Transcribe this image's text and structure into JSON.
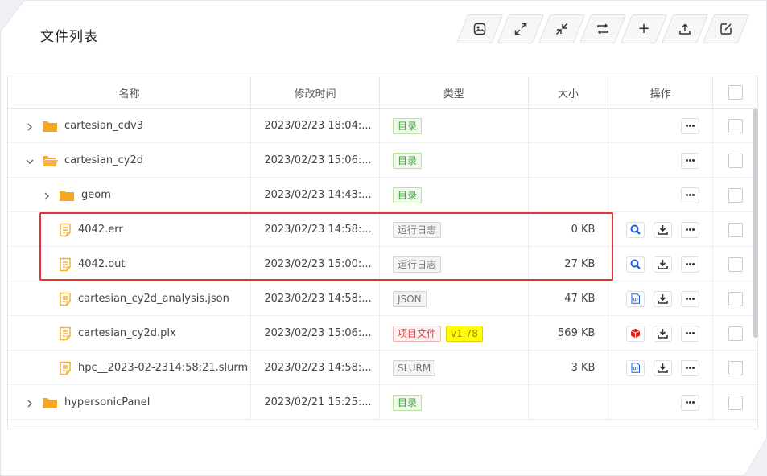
{
  "page": {
    "title": "文件列表"
  },
  "toolbar": {
    "buttons": [
      {
        "icon": "image-icon"
      },
      {
        "icon": "expand-icon"
      },
      {
        "icon": "collapse-icon"
      },
      {
        "icon": "refresh-icon"
      },
      {
        "icon": "plus-icon",
        "label": "+"
      },
      {
        "icon": "upload-icon"
      },
      {
        "icon": "edit-icon"
      }
    ]
  },
  "table": {
    "headers": {
      "name": "名称",
      "time": "修改时间",
      "type": "类型",
      "size": "大小",
      "ops": "操作"
    },
    "rows": [
      {
        "indent": 0,
        "expand": "collapsed",
        "kind": "folder",
        "open": false,
        "name": "cartesian_cdv3",
        "time": "2023/02/23 18:04:...",
        "tags": [
          {
            "text": "目录",
            "style": "green"
          }
        ],
        "size": "",
        "ops": [
          "more"
        ]
      },
      {
        "indent": 0,
        "expand": "expanded",
        "kind": "folder",
        "open": true,
        "name": "cartesian_cy2d",
        "time": "2023/02/23 15:06:...",
        "tags": [
          {
            "text": "目录",
            "style": "green"
          }
        ],
        "size": "",
        "ops": [
          "more"
        ]
      },
      {
        "indent": 1,
        "expand": "collapsed",
        "kind": "folder",
        "open": false,
        "name": "geom",
        "time": "2023/02/23 14:43:...",
        "tags": [
          {
            "text": "目录",
            "style": "green"
          }
        ],
        "size": "",
        "ops": [
          "more"
        ]
      },
      {
        "indent": 1,
        "expand": "none",
        "kind": "file",
        "name": "4042.err",
        "time": "2023/02/23 14:58:...",
        "tags": [
          {
            "text": "运行日志",
            "style": "gray"
          }
        ],
        "size": "0 KB",
        "ops": [
          "search",
          "download",
          "more"
        ]
      },
      {
        "indent": 1,
        "expand": "none",
        "kind": "file",
        "name": "4042.out",
        "time": "2023/02/23 15:00:...",
        "tags": [
          {
            "text": "运行日志",
            "style": "gray"
          }
        ],
        "size": "27 KB",
        "ops": [
          "search",
          "download",
          "more"
        ]
      },
      {
        "indent": 1,
        "expand": "none",
        "kind": "file",
        "name": "cartesian_cy2d_analysis.json",
        "time": "2023/02/23 14:58:...",
        "tags": [
          {
            "text": "JSON",
            "style": "gray"
          }
        ],
        "size": "47 KB",
        "ops": [
          "code",
          "download",
          "more"
        ]
      },
      {
        "indent": 1,
        "expand": "none",
        "kind": "file",
        "name": "cartesian_cy2d.plx",
        "time": "2023/02/23 15:06:...",
        "tags": [
          {
            "text": "项目文件",
            "style": "red"
          },
          {
            "text": "v1.78",
            "style": "yellow"
          }
        ],
        "size": "569 KB",
        "ops": [
          "cube",
          "download",
          "more"
        ]
      },
      {
        "indent": 1,
        "expand": "none",
        "kind": "file",
        "name": "hpc__2023-02-2314:58:21.slurm",
        "time": "2023/02/23 14:58:...",
        "tags": [
          {
            "text": "SLURM",
            "style": "gray"
          }
        ],
        "size": "3 KB",
        "ops": [
          "code",
          "download",
          "more"
        ]
      },
      {
        "indent": 0,
        "expand": "collapsed",
        "kind": "folder",
        "open": false,
        "name": "hypersonicPanel",
        "time": "2023/02/21 15:25:...",
        "tags": [
          {
            "text": "目录",
            "style": "green"
          }
        ],
        "size": "",
        "ops": [
          "more"
        ]
      }
    ]
  },
  "colors": {
    "folder": "#f5a623",
    "file": "#f2b23a",
    "highlight": "#e53232",
    "search": "#1a5fd6",
    "cube": "#e02222"
  }
}
